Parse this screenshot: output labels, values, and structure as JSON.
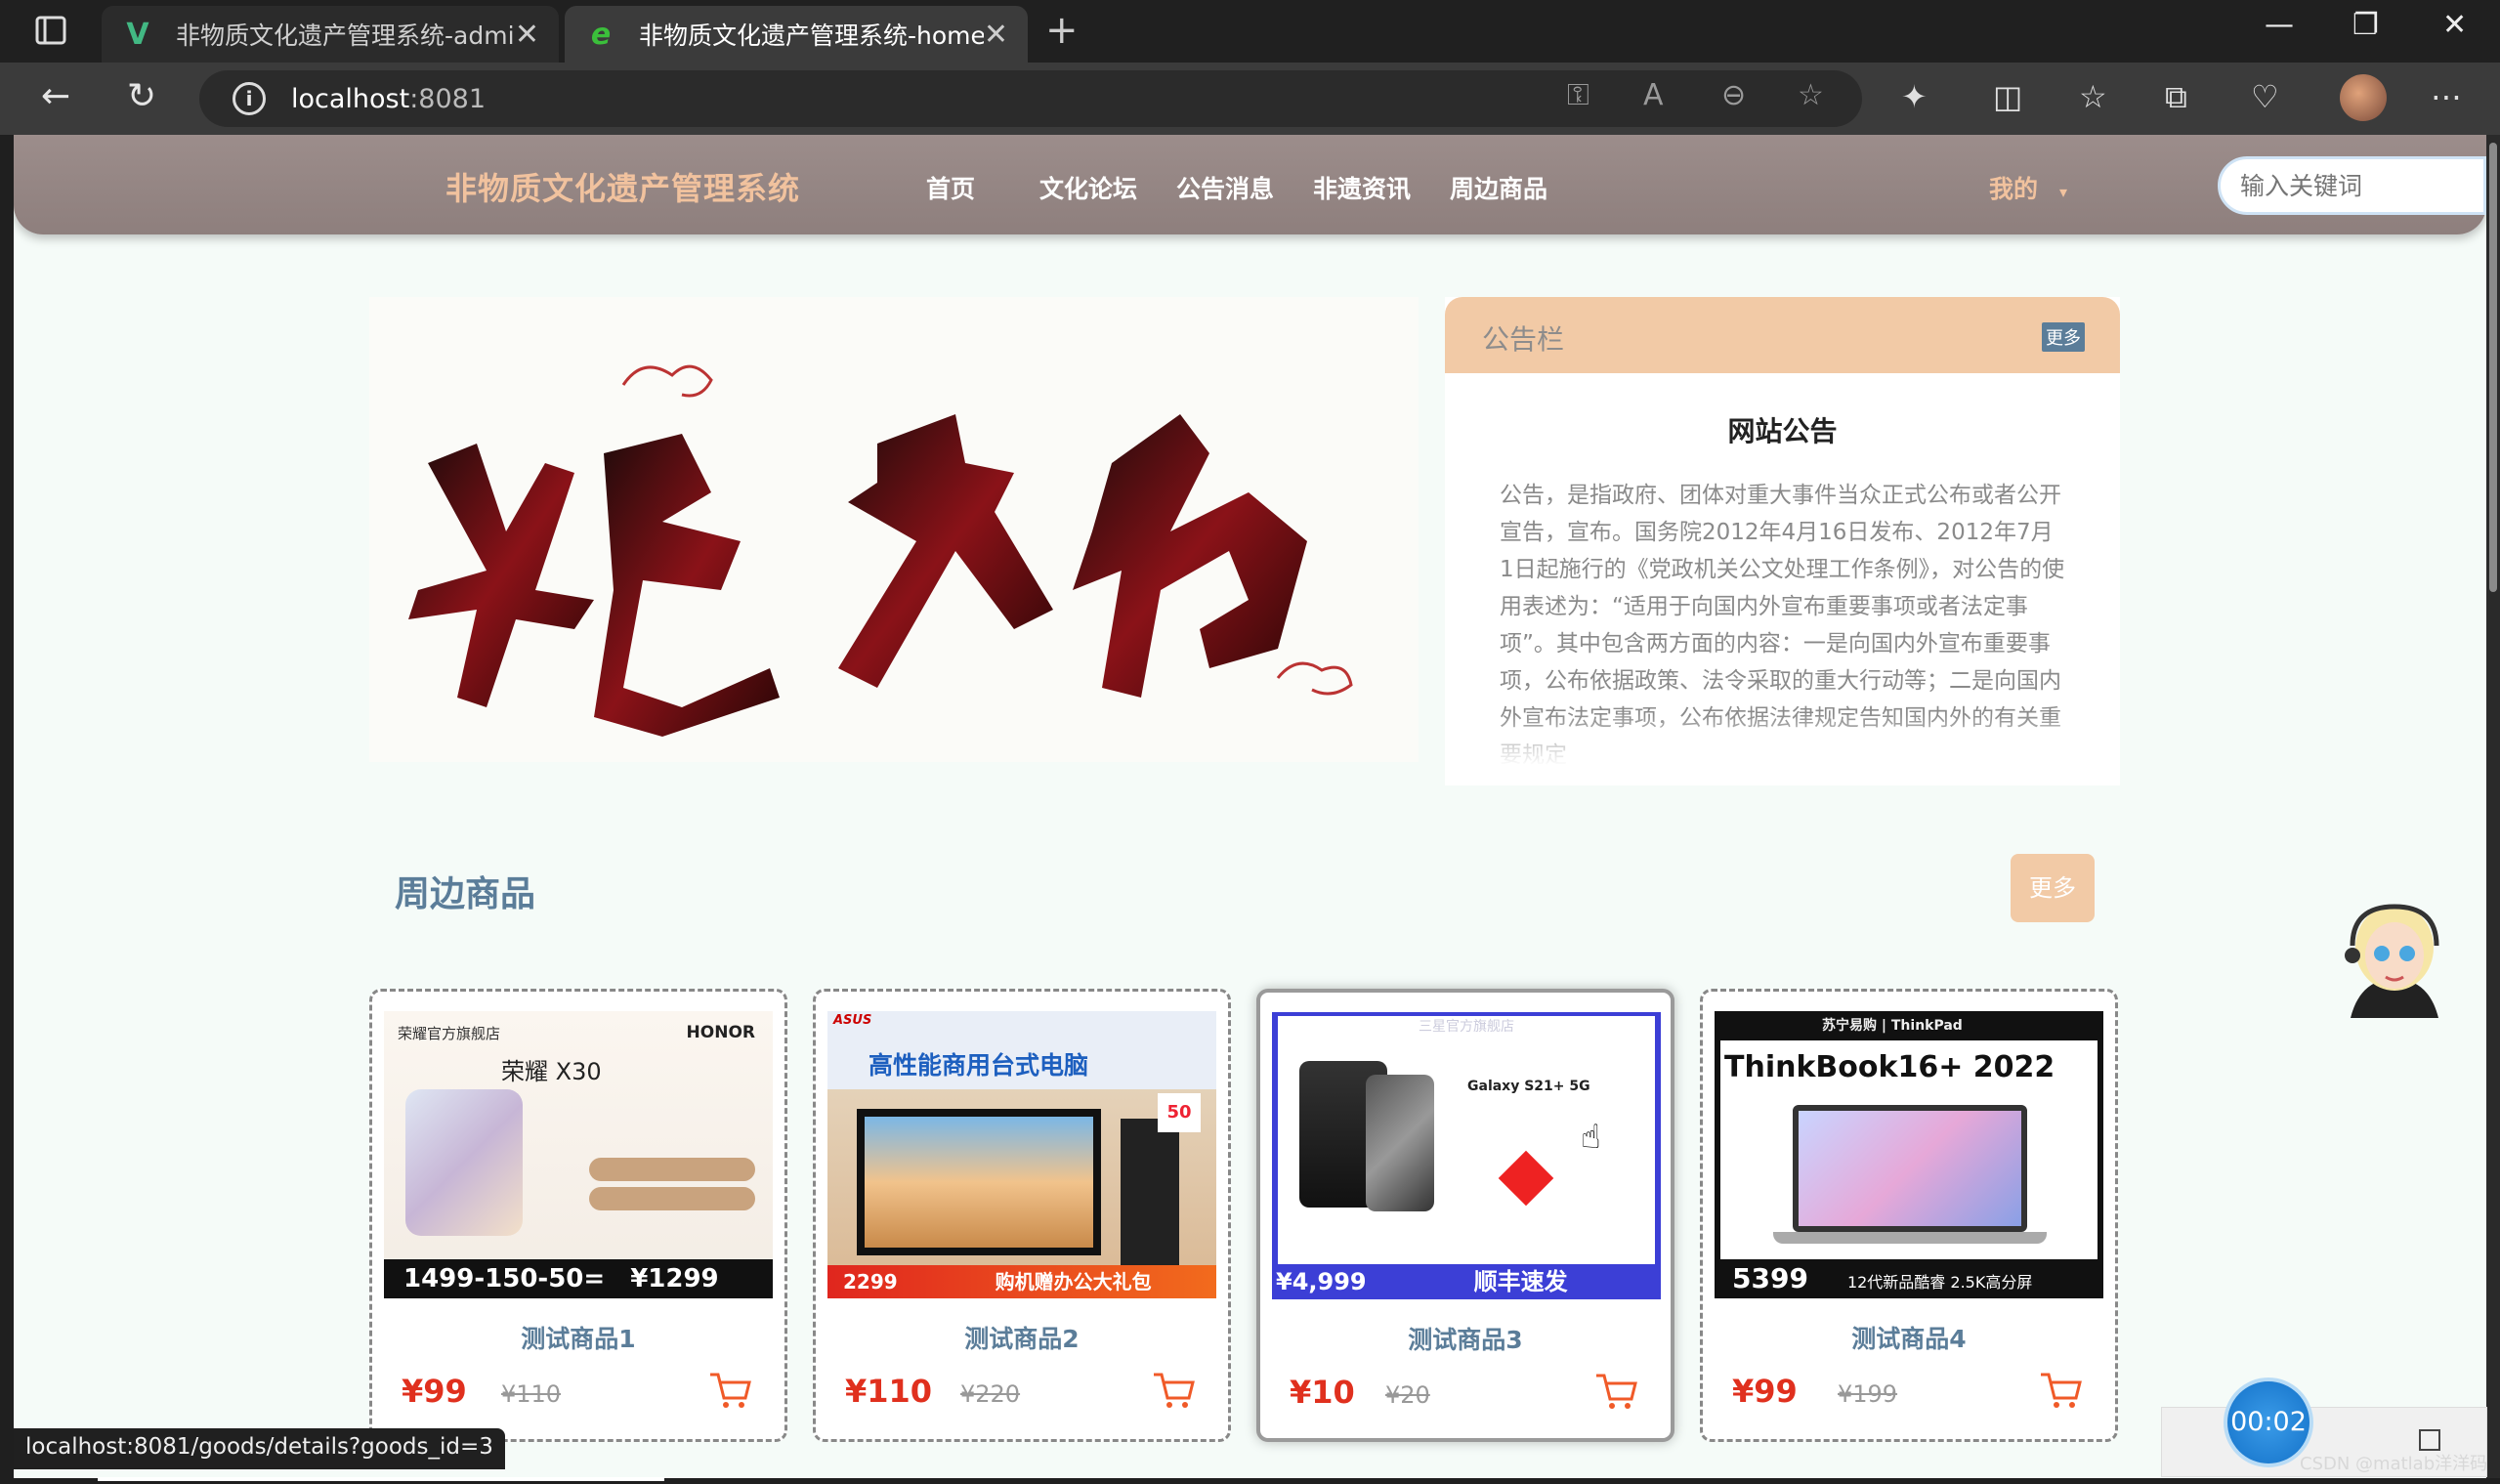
{
  "browser": {
    "tabs": [
      {
        "title": "非物质文化遗产管理系统-admin",
        "favicon": "vue-icon",
        "favicon_color": "#42b883"
      },
      {
        "title": "非物质文化遗产管理系统-home",
        "favicon": "edge-e-icon",
        "favicon_color": "#3bbf3b"
      }
    ],
    "url_host": "localhost",
    "url_port": ":8081",
    "status_url": "localhost:8081/goods/details?goods_id=3"
  },
  "header": {
    "logo": "非物质文化遗产管理系统",
    "nav": [
      "首页",
      "文化论坛",
      "公告消息",
      "非遗资讯",
      "周边商品"
    ],
    "mine": "我的",
    "search_placeholder": "输入关键词"
  },
  "banner": {
    "alt": "非遗文化"
  },
  "notice": {
    "title": "公告栏",
    "more": "更多",
    "heading": "网站公告",
    "body": "公告，是指政府、团体对重大事件当众正式公布或者公开宣告，宣布。国务院2012年4月16日发布、2012年7月1日起施行的《党政机关公文处理工作条例》，对公告的使用表述为：“适用于向国内外宣布重要事项或者法定事项”。其中包含两方面的内容：一是向国内外宣布重要事项，公布依据政策、法令采取的重大行动等；二是向国内外宣布法定事项，公布依据法律规定告知国内外的有关重要规定"
  },
  "goods": {
    "title": "周边商品",
    "more": "更多",
    "items": [
      {
        "name": "测试商品1",
        "price": "¥99",
        "old": "¥110",
        "img_brand": "HONOR",
        "img_model": "荣耀 X30",
        "img_price": "1499-150-50=",
        "img_final": "¥1299"
      },
      {
        "name": "测试商品2",
        "price": "¥110",
        "old": "¥220",
        "img_brand": "ASUS",
        "img_model": "高性能商用台式电脑",
        "img_price": "2299",
        "img_final": "购机赠办公大礼包"
      },
      {
        "name": "测试商品3",
        "price": "¥10",
        "old": "¥20",
        "img_brand": "三星官方旗舰店",
        "img_model": "Galaxy S21+ 5G",
        "img_price": "¥4,999",
        "img_final": "顺丰速发"
      },
      {
        "name": "测试商品4",
        "price": "¥99",
        "old": "¥199",
        "img_brand": "ThinkPad",
        "img_model": "ThinkBook16+ 2022",
        "img_price": "5399",
        "img_final": "12代新品酷睿 2.5K高分屏"
      }
    ]
  },
  "timer": "00:02",
  "watermark": "CSDN @matlab洋洋码",
  "colors": {
    "header_bg": "#9c8d8b",
    "accent": "#f2caa6",
    "title_blue": "#5b7d99",
    "price_red": "#e0301e"
  }
}
